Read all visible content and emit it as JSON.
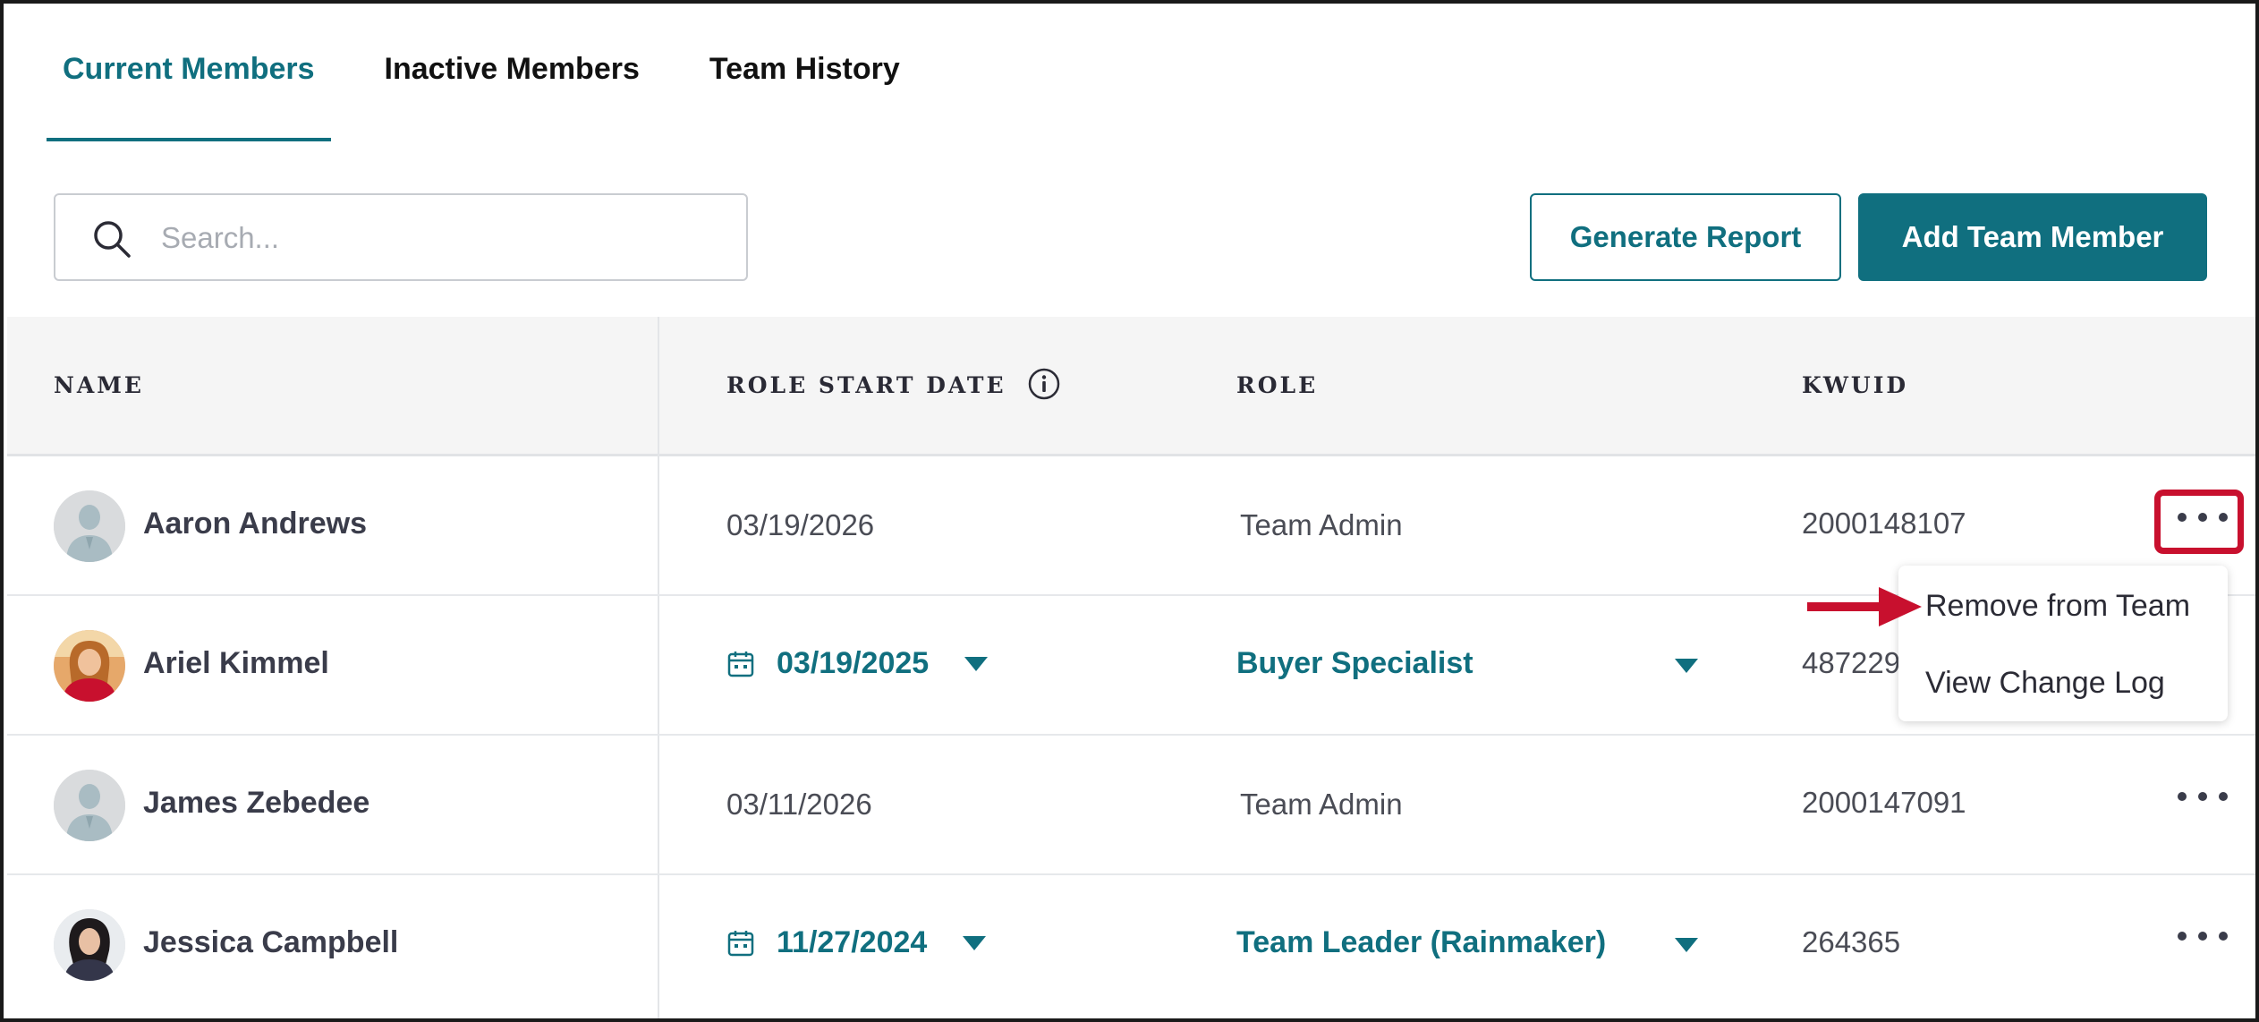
{
  "tabs": [
    {
      "label": "Current Members",
      "active": true
    },
    {
      "label": "Inactive Members",
      "active": false
    },
    {
      "label": "Team History",
      "active": false
    }
  ],
  "search": {
    "placeholder": "Search..."
  },
  "buttons": {
    "generate_report": "Generate Report",
    "add_team_member": "Add Team Member"
  },
  "table": {
    "headers": {
      "name": "NAME",
      "role_start_date": "ROLE START DATE",
      "role": "ROLE",
      "kwuid": "KWUID"
    },
    "rows": [
      {
        "name": "Aaron Andrews",
        "date": "03/19/2026",
        "role": "Team Admin",
        "kwuid": "2000148107",
        "editable": false,
        "avatar": "placeholder"
      },
      {
        "name": "Ariel Kimmel",
        "date": "03/19/2025",
        "role": "Buyer Specialist",
        "kwuid": "487229",
        "editable": true,
        "avatar": "photo"
      },
      {
        "name": "James Zebedee",
        "date": "03/11/2026",
        "role": "Team Admin",
        "kwuid": "2000147091",
        "editable": false,
        "avatar": "placeholder"
      },
      {
        "name": "Jessica Campbell",
        "date": "11/27/2024",
        "role": "Team Leader (Rainmaker)",
        "kwuid": "264365",
        "editable": true,
        "avatar": "photo"
      }
    ]
  },
  "row_menu": {
    "items": [
      "Remove from Team",
      "View Change Log"
    ]
  },
  "colors": {
    "accent": "#106f7f",
    "highlight": "#c8102e",
    "header_bg": "#f5f5f5"
  }
}
